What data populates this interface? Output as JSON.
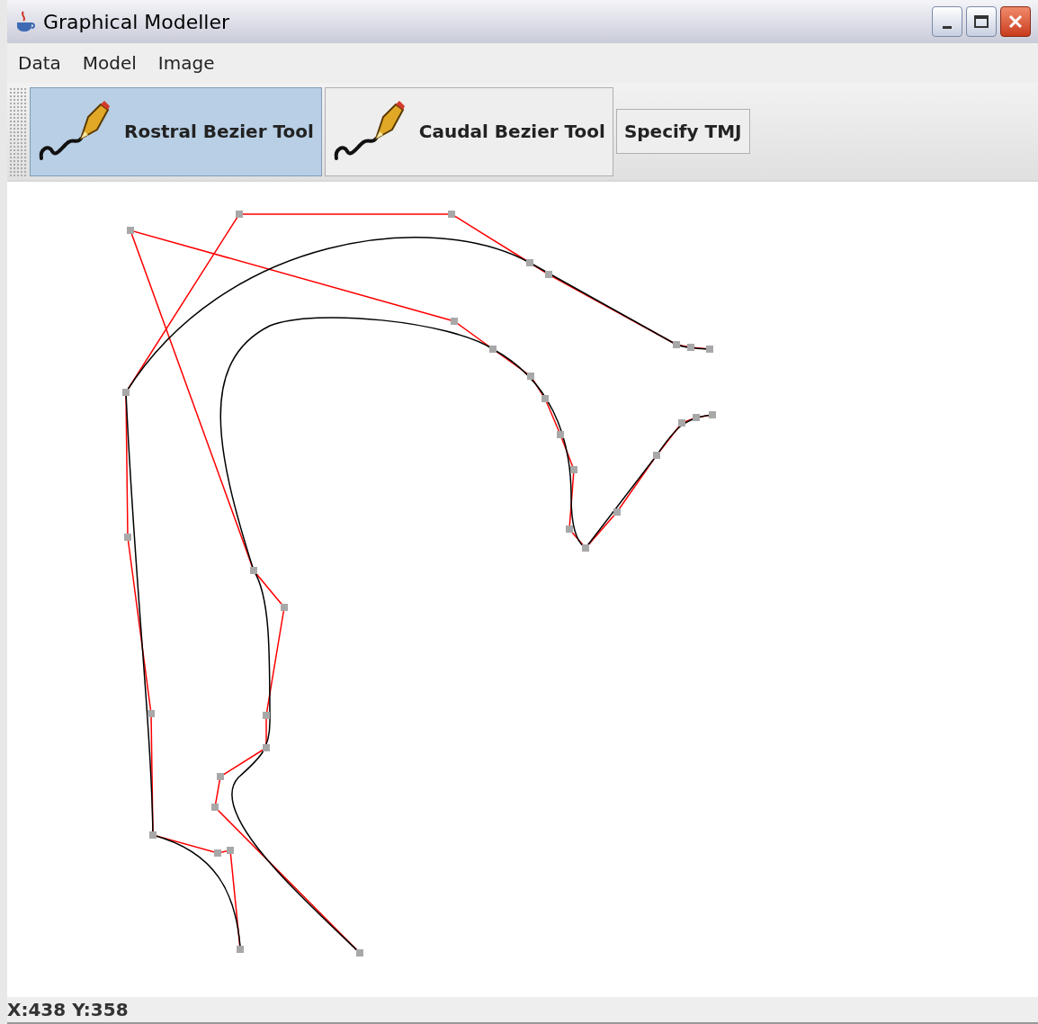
{
  "window": {
    "title": "Graphical Modeller"
  },
  "menu": [
    "Data",
    "Model",
    "Image"
  ],
  "toolbar": [
    {
      "label": "Rostral Bezier Tool",
      "kind": "tool",
      "selected": true
    },
    {
      "label": "Caudal Bezier Tool",
      "kind": "tool",
      "selected": false
    },
    {
      "label": "Specify TMJ",
      "kind": "plain",
      "selected": false
    }
  ],
  "status_bar": "X:438 Y:358"
}
